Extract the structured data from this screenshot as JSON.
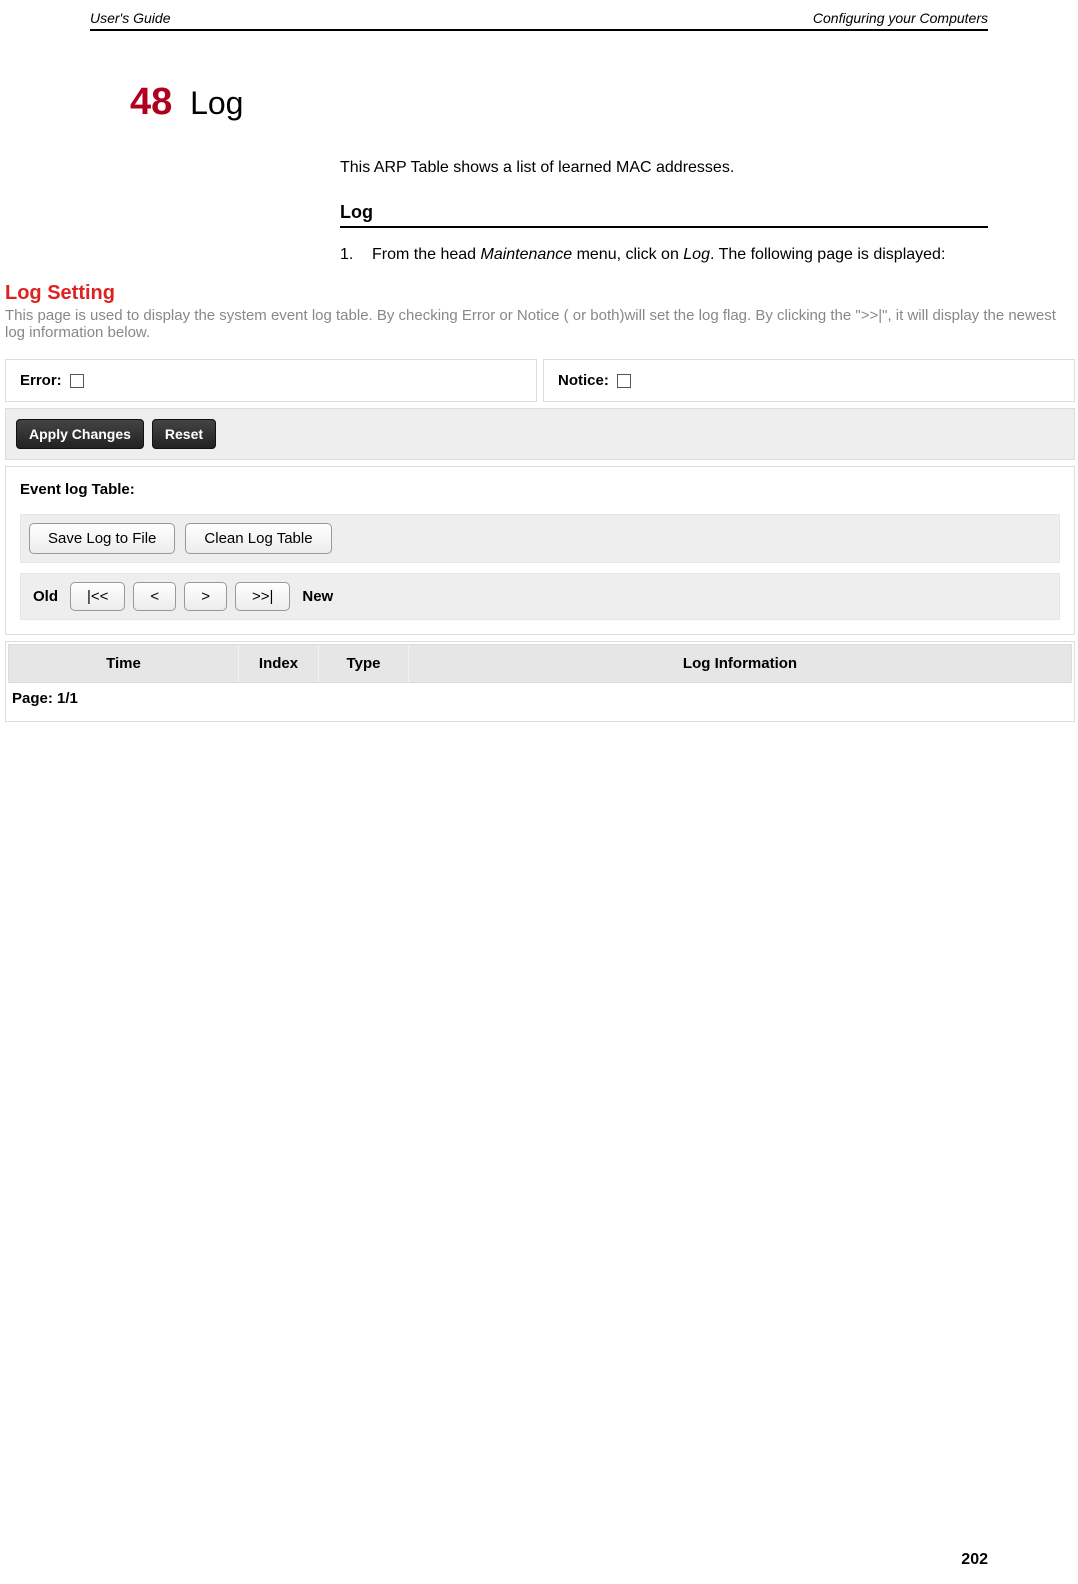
{
  "header": {
    "left": "User's Guide",
    "right": "Configuring your Computers"
  },
  "chapter": {
    "number": "48",
    "title": "Log"
  },
  "intro": "This ARP Table shows a list of learned MAC addresses.",
  "section_title": "Log",
  "step": {
    "number": "1.",
    "prefix": "From the head ",
    "menu": "Maintenance",
    "mid": " menu, click on ",
    "item": "Log",
    "suffix": ". The following page is displayed:"
  },
  "logSetting": {
    "title": "Log Setting",
    "description": "This page is used to display the system event log table. By checking Error or Notice ( or both)will set the log flag. By clicking the \">>|\", it will display the newest log information below."
  },
  "checkboxes": {
    "error": "Error:",
    "notice": "Notice:"
  },
  "buttons": {
    "apply": "Apply Changes",
    "reset": "Reset",
    "saveLog": "Save Log to File",
    "cleanLog": "Clean Log Table"
  },
  "eventLogTitle": "Event log Table:",
  "nav": {
    "old": "Old",
    "first": "|<<",
    "prev": "<",
    "next": ">",
    "last": ">>|",
    "new": "New"
  },
  "table": {
    "headers": {
      "time": "Time",
      "index": "Index",
      "type": "Type",
      "info": "Log Information"
    },
    "pageLabel": "Page: 1/1"
  },
  "pageNumber": "202"
}
